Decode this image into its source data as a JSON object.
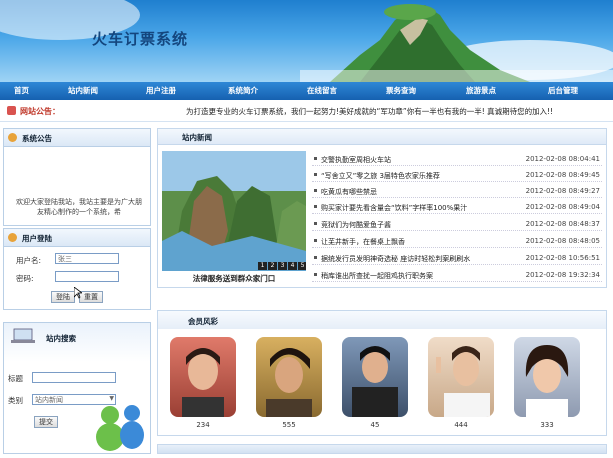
{
  "site": {
    "title": "火车订票系统"
  },
  "nav": {
    "items": [
      {
        "label": "首页"
      },
      {
        "label": "站内新闻"
      },
      {
        "label": "用户注册"
      },
      {
        "label": "系统简介"
      },
      {
        "label": "在线留言"
      },
      {
        "label": "票务查询"
      },
      {
        "label": "旅游景点"
      },
      {
        "label": "后台管理"
      }
    ]
  },
  "notice": {
    "label": "网站公告：",
    "text": "为打造更专业的火车订票系统，我们一起努力!美好成就的“军功章”你有一半也有我的一半! 真诚期待您的加入!!"
  },
  "announce": {
    "title": "系统公告",
    "body": "欢迎大家登陆我站，我站主要是为广大朋友精心制作的一个系统，希"
  },
  "login": {
    "title": "用户登陆",
    "username_label": "用户名:",
    "username_value": "张三",
    "password_label": "密码:",
    "login_button": "登陆",
    "reset_button": "重置"
  },
  "search": {
    "title": "站内搜索",
    "title_label": "标题",
    "category_label": "类别",
    "category_value": "站内新闻",
    "submit_button": "提交"
  },
  "news": {
    "title": "站内新闻",
    "photo_caption": "法律服务送到群众家门口",
    "photo_tabs": [
      "1",
      "2",
      "3",
      "4",
      "5"
    ],
    "items": [
      {
        "title": "交警执勤室周相火车站",
        "date": "2012-02-08 08:04:41"
      },
      {
        "title": "“写舍立又”零之旅 3届特色农家乐推荐",
        "date": "2012-02-08 08:49:45"
      },
      {
        "title": "吃黄瓜有哪些禁忌",
        "date": "2012-02-08 08:49:27"
      },
      {
        "title": "购买家计要先看含量会“饮料”字样率100%果汁",
        "date": "2012-02-08 08:49:04"
      },
      {
        "title": "竞狱们为何酷爱鱼子酱",
        "date": "2012-02-08 08:48:37"
      },
      {
        "title": "让芜井新手，在餐桌上飘香",
        "date": "2012-02-08 08:48:05"
      },
      {
        "title": "据统发行员发明神奇选秘 座访时轻松判案刷刷水",
        "date": "2012-02-08 10:56:51"
      },
      {
        "title": "稍库谁出所查扰一起阻鸡执行职务案",
        "date": "2012-02-08 19:32:34"
      }
    ]
  },
  "members": {
    "title": "会员风彩",
    "items": [
      {
        "label": "234"
      },
      {
        "label": "555"
      },
      {
        "label": "45"
      },
      {
        "label": "444"
      },
      {
        "label": "333"
      }
    ]
  }
}
